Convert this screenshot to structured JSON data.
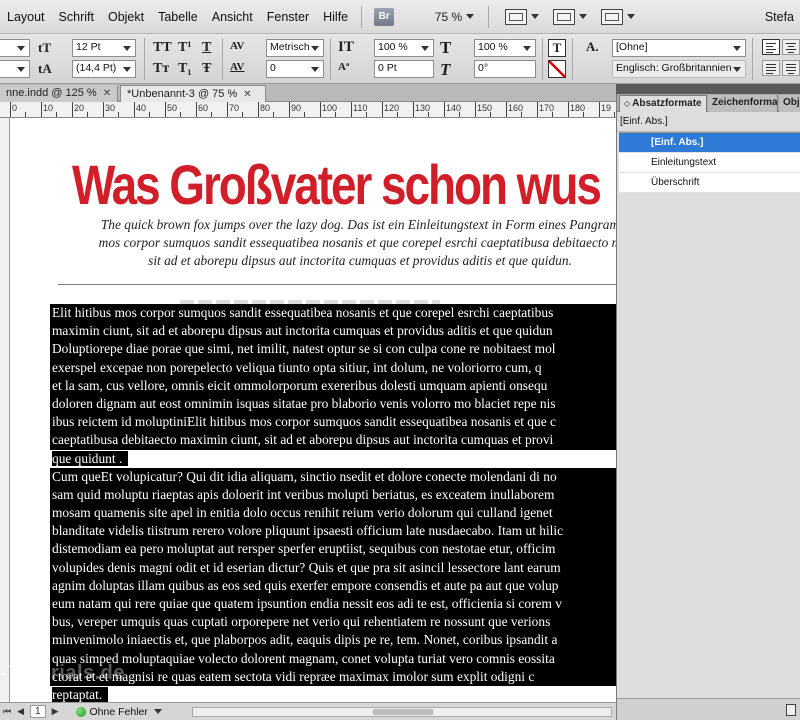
{
  "menubar": {
    "items": [
      "Layout",
      "Schrift",
      "Objekt",
      "Tabelle",
      "Ansicht",
      "Fenster",
      "Hilfe"
    ],
    "bridge_label": "Br",
    "zoom": "75 %",
    "user": "Stefa"
  },
  "control": {
    "font_size": "12 Pt",
    "leading": "(14,4 Pt)",
    "kerning": "Metrisch",
    "tracking": "0",
    "vscale": "100 %",
    "hscale": "100 %",
    "baseline": "0 Pt",
    "skew": "0°",
    "char_style": "[Ohne]",
    "language": "Englisch: Großbritannien",
    "glyphs": {
      "tt_caps": "TT",
      "tt_super": "T¹",
      "t_under": "T",
      "tt_small": "Tт",
      "t_sub": "T₁",
      "t_strike": "Ŧ"
    }
  },
  "tabs": [
    {
      "label": "nne.indd @ 125 %",
      "active": false
    },
    {
      "label": "*Unbenannt-3 @ 75 %",
      "active": true
    }
  ],
  "ruler": {
    "labels": [
      "0",
      "10",
      "20",
      "30",
      "40",
      "50",
      "60",
      "70",
      "80",
      "90",
      "100",
      "110",
      "120",
      "130",
      "140",
      "150",
      "160",
      "170",
      "180",
      "19"
    ]
  },
  "document": {
    "headline": "Was Großvater schon wus",
    "intro_lines": [
      "The quick brown fox jumps over the lazy dog. Das ist ein Einleitungstext in Form eines Pangram",
      "mos corpor sumquos sandit essequatibea nosanis et que corepel esrchi caeptatibusa debitaecto m",
      "sit ad et aborepu dipsus aut inctorita cumquas et providus aditis et que quidun."
    ],
    "body_lines": [
      "Elit hitibus mos corpor sumquos sandit essequatibea nosanis et que corepel esrchi caeptatibus",
      "maximin ciunt, sit ad et aborepu dipsus aut inctorita cumquas et providus aditis et que quidun",
      "Doluptiorepe diae porae que simi, net imilit, natest optur se si con culpa cone re nobitaest mol",
      "exerspel excepae non porepelecto veliqua tiunto opta sitiur, int dolum, ne voloriorro cum, q",
      "et la sam, cus vellore, omnis eicit ommolorporum exereribus dolesti umquam apienti onsequ",
      "doloren dignam aut eost omnimin isquas sitatae pro blaborio venis volorro mo blaciet repe nis",
      "ibus reictem id moluptiniElit hitibus mos corpor sumquos sandit essequatibea nosanis et que c",
      "caeptatibusa debitaecto maximin ciunt, sit ad et aborepu dipsus aut inctorita cumquas et provi",
      "que quidunt .",
      "Cum queEt volupicatur? Qui dit idia aliquam, sinctio nsedit et dolore conecte molendani di no",
      "sam quid moluptu riaeptas apis doloerit int veribus molupti beriatus, es exceatem inullaborem",
      "mosam quamenis site apel in enitia dolo occus renihit reium verio dolorum qui culland igenet",
      "blanditate videlis tiistrum rerero volore pliquunt ipsaesti officium late nusdaecabo. Itam ut hilic",
      "distemodiam ea pero moluptat aut rersper sperfer eruptiist, sequibus con nestotae etur, officim",
      "volupides denis magni odit et id eserian dictur? Quis et que pra sit asincil lessectore lant earum",
      "agnim doluptas illam quibus as eos sed quis exerfer empore consendis et aute pa aut que volup",
      "eum natam qui rere quiae que quatem ipsuntion endia nessit eos adi te est, officienia si corem v",
      "bus, vereper umquis quas cuptati orporepere net verio qui rehentiatem re nossunt que verions",
      "minvenimolo iniaectis et, que plaborpos adit, eaquis dipis pe re, tem. Nonet, coribus ipsandit a",
      "quas simped moluptaquiae volecto dolorent magnam, conet volupta turiat vero comnis eossita",
      "ctorat et et magnisi re quas eatem sectota vidi repræe maximax imolor sum explit odigni c",
      "reptaptat."
    ]
  },
  "watermark": "-Tutorials.de",
  "statusbar": {
    "page": "1",
    "status": "Ohne Fehler"
  },
  "panel": {
    "tabs": [
      "Absatzformate",
      "Zeichenforma",
      "Obj"
    ],
    "current_style": "[Einf. Abs.]",
    "styles": [
      {
        "label": "[Einf. Abs.]",
        "selected": true
      },
      {
        "label": "Einleitungstext",
        "selected": false
      },
      {
        "label": "Überschrift",
        "selected": false
      }
    ]
  }
}
